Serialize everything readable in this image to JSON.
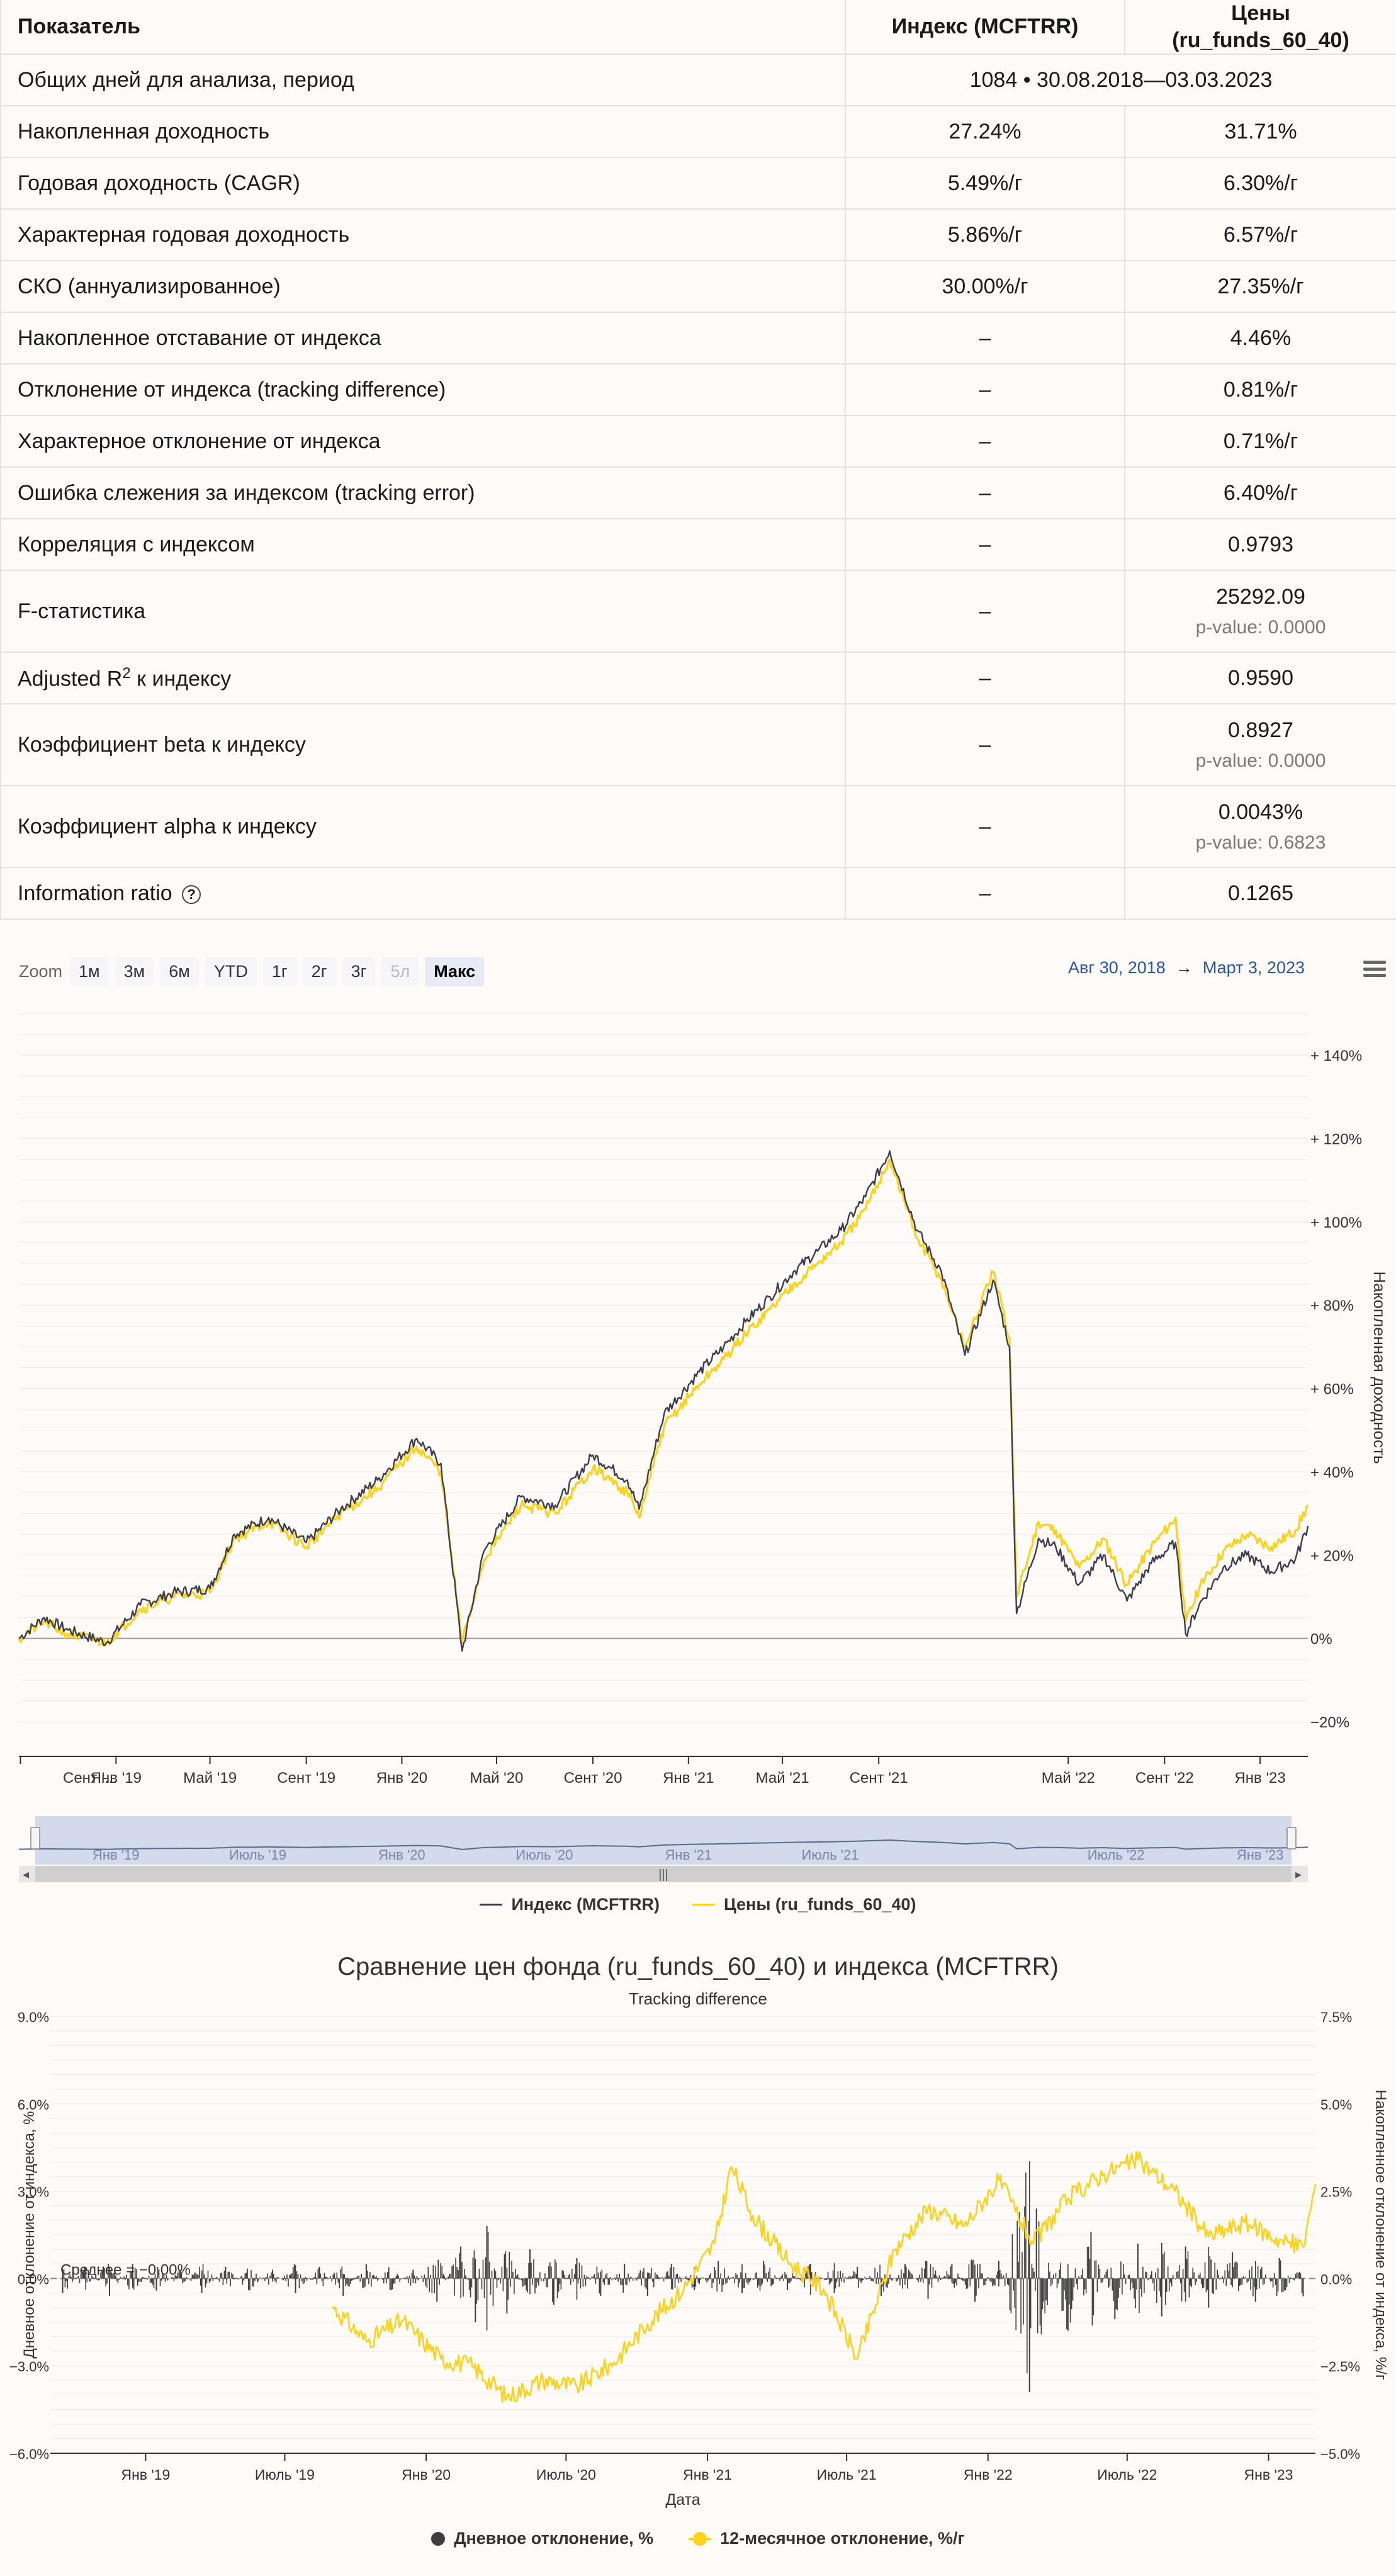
{
  "table": {
    "headers": [
      "Показатель",
      "Индекс (MCFTRR)",
      "Цены (ru_funds_60_40)"
    ],
    "period_row": {
      "label": "Общих дней для анализа, период",
      "value": "1084 • 30.08.2018—03.03.2023"
    },
    "rows": [
      {
        "label": "Накопленная доходность",
        "index": "27.24%",
        "fund": "31.71%"
      },
      {
        "label": "Годовая доходность (CAGR)",
        "index": "5.49%/г",
        "fund": "6.30%/г"
      },
      {
        "label": "Характерная годовая доходность",
        "index": "5.86%/г",
        "fund": "6.57%/г"
      },
      {
        "label": "СКО (аннуализированное)",
        "index": "30.00%/г",
        "fund": "27.35%/г"
      },
      {
        "label": "Накопленное отставание от индекса",
        "index": "–",
        "fund": "4.46%"
      },
      {
        "label": "Отклонение от индекса (tracking difference)",
        "index": "–",
        "fund": "0.81%/г"
      },
      {
        "label": "Характерное отклонение от индекса",
        "index": "–",
        "fund": "0.71%/г"
      },
      {
        "label": "Ошибка слежения за индексом (tracking error)",
        "index": "–",
        "fund": "6.40%/г"
      },
      {
        "label": "Корреляция с индексом",
        "index": "–",
        "fund": "0.9793"
      }
    ],
    "fstat": {
      "label": "F-статистика",
      "index": "–",
      "fund": "25292.09",
      "pvalue": "p-value: 0.0000"
    },
    "adj_r2": {
      "label_pre": "Adjusted R",
      "label_sup": "2",
      "label_post": " к индексу",
      "index": "–",
      "fund": "0.9590"
    },
    "beta": {
      "label": "Коэффициент beta к индексу",
      "index": "–",
      "fund": "0.8927",
      "pvalue": "p-value: 0.0000"
    },
    "alpha": {
      "label": "Коэффициент alpha к индексу",
      "index": "–",
      "fund": "0.0043%",
      "pvalue": "p-value: 0.6823"
    },
    "info_ratio": {
      "label": "Information ratio",
      "help": "?",
      "index": "–",
      "fund": "0.1265"
    }
  },
  "chart1_controls": {
    "zoom_label": "Zoom",
    "zoom_buttons": [
      "1м",
      "3м",
      "6м",
      "YTD",
      "1г",
      "2г",
      "3г",
      "5л",
      "Макс"
    ],
    "disabled_button": "5л",
    "active_button": "Макс",
    "range_from": "Авг 30, 2018",
    "range_arrow": "→",
    "range_to": "Март 3, 2023"
  },
  "colors": {
    "index": "#3d3d4c",
    "fund": "#ffd21a",
    "grid": "#e9e6e4",
    "navigator": "#cbd3ea",
    "accent_link": "#2a55a5"
  },
  "chart_data": [
    {
      "type": "line",
      "ylabel": "Накопленная доходность",
      "ylim": [
        -20,
        150
      ],
      "y_ticks": [
        "+ 140%",
        "+ 120%",
        "+ 100%",
        "+ 80%",
        "+ 60%",
        "+ 40%",
        "+ 20%",
        "0%",
        "−20%"
      ],
      "y_tick_values": [
        140,
        120,
        100,
        80,
        60,
        40,
        20,
        0,
        -20
      ],
      "x_ticks": [
        "Сент '...",
        "Янв '19",
        "Май '19",
        "Сент '19",
        "Янв '20",
        "Май '20",
        "Сент '20",
        "Янв '21",
        "Май '21",
        "Сент '21",
        "Май '22",
        "Сент '22",
        "Янв '23"
      ],
      "x_tick_dates": [
        "2018-09-01",
        "2019-01-01",
        "2019-05-01",
        "2019-09-01",
        "2020-01-01",
        "2020-05-01",
        "2020-09-01",
        "2021-01-01",
        "2021-05-01",
        "2021-09-01",
        "2022-05-01",
        "2022-09-01",
        "2023-01-01"
      ],
      "x_range": [
        "2018-08-30",
        "2023-03-03"
      ],
      "navigator_ticks": [
        "Янв '19",
        "Июль '19",
        "Янв '20",
        "Июль '20",
        "Янв '21",
        "Июль '21",
        "Июль '22",
        "Янв '23"
      ],
      "navigator_tick_dates": [
        "2019-01-01",
        "2019-07-01",
        "2020-01-01",
        "2020-07-01",
        "2021-01-01",
        "2021-07-01",
        "2022-07-01",
        "2023-01-01"
      ],
      "series": [
        {
          "name": "Индекс (MCFTRR)",
          "x": [
            "2018-08-30",
            "2018-10-01",
            "2018-11-01",
            "2018-12-20",
            "2019-02-01",
            "2019-03-15",
            "2019-05-01",
            "2019-06-01",
            "2019-07-15",
            "2019-09-01",
            "2019-10-15",
            "2019-12-01",
            "2020-01-20",
            "2020-02-20",
            "2020-03-18",
            "2020-04-15",
            "2020-06-01",
            "2020-07-15",
            "2020-09-01",
            "2020-10-15",
            "2020-10-30",
            "2020-12-01",
            "2021-01-15",
            "2021-02-15",
            "2021-03-15",
            "2021-04-15",
            "2021-05-15",
            "2021-06-15",
            "2021-07-15",
            "2021-08-15",
            "2021-09-15",
            "2021-10-20",
            "2021-11-20",
            "2021-12-20",
            "2022-01-25",
            "2022-02-15",
            "2022-02-24",
            "2022-03-24",
            "2022-04-15",
            "2022-05-15",
            "2022-06-15",
            "2022-07-15",
            "2022-08-15",
            "2022-09-15",
            "2022-09-28",
            "2022-10-15",
            "2022-11-15",
            "2022-12-15",
            "2023-01-15",
            "2023-02-15",
            "2023-03-03"
          ],
          "y": [
            0,
            5,
            2,
            -1,
            8,
            11,
            12,
            25,
            29,
            23,
            31,
            38,
            48,
            42,
            -3,
            21,
            34,
            32,
            44,
            38,
            31,
            54,
            64,
            70,
            76,
            82,
            88,
            93,
            98,
            106,
            117,
            98,
            88,
            68,
            86,
            70,
            6,
            24,
            22,
            13,
            20,
            9,
            18,
            23,
            1,
            8,
            17,
            20,
            16,
            19,
            27
          ]
        },
        {
          "name": "Цены (ru_funds_60_40)",
          "x": [
            "2018-08-30",
            "2018-10-01",
            "2018-11-01",
            "2018-12-20",
            "2019-02-01",
            "2019-03-15",
            "2019-05-01",
            "2019-06-01",
            "2019-07-15",
            "2019-09-01",
            "2019-10-15",
            "2019-12-01",
            "2020-01-20",
            "2020-02-20",
            "2020-03-18",
            "2020-04-15",
            "2020-06-01",
            "2020-07-15",
            "2020-09-01",
            "2020-10-15",
            "2020-10-30",
            "2020-12-01",
            "2021-01-15",
            "2021-02-15",
            "2021-03-15",
            "2021-04-15",
            "2021-05-15",
            "2021-06-15",
            "2021-07-15",
            "2021-08-15",
            "2021-09-15",
            "2021-10-20",
            "2021-11-20",
            "2021-12-20",
            "2022-01-25",
            "2022-02-15",
            "2022-02-24",
            "2022-03-24",
            "2022-04-15",
            "2022-05-15",
            "2022-06-15",
            "2022-07-15",
            "2022-08-15",
            "2022-09-15",
            "2022-09-28",
            "2022-10-15",
            "2022-11-15",
            "2022-12-15",
            "2023-01-15",
            "2023-02-15",
            "2023-03-03"
          ],
          "y": [
            0,
            4,
            1,
            -1,
            7,
            10,
            11,
            24,
            28,
            22,
            30,
            36,
            46,
            40,
            -1,
            19,
            32,
            30,
            41,
            35,
            29,
            51,
            61,
            67,
            73,
            79,
            85,
            90,
            95,
            103,
            115,
            96,
            86,
            70,
            88,
            72,
            10,
            28,
            26,
            17,
            24,
            13,
            22,
            29,
            4,
            12,
            21,
            25,
            22,
            26,
            32
          ]
        }
      ]
    },
    {
      "type": "bar",
      "title": "Сравнение цен фонда (ru_funds_60_40) и индекса (MCFTRR)",
      "subtitle": "Tracking difference",
      "xlabel": "Дата",
      "ylabel": "Дневное отклонение от индекса, %",
      "ylabel_right": "Накопленное отклонение от индекса, %/г",
      "ylim": [
        -6,
        9
      ],
      "ylim_right": [
        -5,
        7.5
      ],
      "y_ticks": [
        "9.0%",
        "6.0%",
        "3.0%",
        "0.0%",
        "−3.0%",
        "−6.0%"
      ],
      "y_tick_values": [
        9,
        6,
        3,
        0,
        -3,
        -6
      ],
      "y_ticks_right": [
        "7.5%",
        "5.0%",
        "2.5%",
        "0.0%",
        "−2.5%",
        "−5.0%"
      ],
      "y_tick_values_right": [
        7.5,
        5,
        2.5,
        0,
        -2.5,
        -5
      ],
      "x_ticks": [
        "Янв '19",
        "Июль '19",
        "Янв '20",
        "Июль '20",
        "Янв '21",
        "Июль '21",
        "Янв '22",
        "Июль '22",
        "Янв '23"
      ],
      "x_tick_dates": [
        "2019-01-01",
        "2019-07-01",
        "2020-01-01",
        "2020-07-01",
        "2021-01-01",
        "2021-07-01",
        "2022-01-01",
        "2022-07-01",
        "2023-01-01"
      ],
      "x_range": [
        "2018-08-30",
        "2023-03-03"
      ],
      "mean_label": "Среднее = −0.00%",
      "mean_value": 0,
      "series": [
        {
          "name": "Дневное отклонение, %",
          "x": [
            "2018-09-15",
            "2018-10-15",
            "2018-11-15",
            "2018-12-15",
            "2019-01-15",
            "2019-02-15",
            "2019-03-15",
            "2019-04-15",
            "2019-05-15",
            "2019-06-15",
            "2019-07-15",
            "2019-08-15",
            "2019-09-15",
            "2019-10-15",
            "2019-11-15",
            "2019-12-15",
            "2020-01-15",
            "2020-02-15",
            "2020-03-05",
            "2020-03-20",
            "2020-04-15",
            "2020-05-15",
            "2020-06-15",
            "2020-07-15",
            "2020-08-15",
            "2020-09-15",
            "2020-10-15",
            "2020-11-15",
            "2020-12-15",
            "2021-01-15",
            "2021-02-15",
            "2021-03-15",
            "2021-04-15",
            "2021-05-15",
            "2021-06-15",
            "2021-07-15",
            "2021-08-15",
            "2021-09-15",
            "2021-10-15",
            "2021-11-15",
            "2021-12-15",
            "2022-01-15",
            "2022-02-24",
            "2022-03-05",
            "2022-04-15",
            "2022-05-15",
            "2022-06-15",
            "2022-07-15",
            "2022-08-15",
            "2022-09-15",
            "2022-10-15",
            "2022-11-15",
            "2022-12-15",
            "2023-01-15",
            "2023-02-15"
          ],
          "y": [
            -0.5,
            0.4,
            -0.6,
            0.5,
            -0.4,
            0.3,
            -0.5,
            0.4,
            -0.4,
            0.3,
            -0.5,
            0.4,
            -0.6,
            0.5,
            -0.4,
            0.3,
            -0.8,
            1.1,
            -1.5,
            1.8,
            -1.2,
            1.0,
            -0.9,
            0.7,
            -0.6,
            0.5,
            -0.6,
            0.5,
            -0.4,
            0.6,
            -0.5,
            0.6,
            -0.4,
            0.5,
            -0.5,
            0.4,
            -0.6,
            0.5,
            -0.7,
            0.5,
            -0.8,
            0.6,
            -3.9,
            2.4,
            -1.8,
            1.6,
            -1.4,
            1.2,
            -1.3,
            1.1,
            -1.0,
            0.9,
            -0.8,
            0.7,
            -0.6
          ]
        },
        {
          "name": "12-месячное отклонение, %/г",
          "x": [
            "2019-09-01",
            "2019-10-15",
            "2019-12-01",
            "2020-01-20",
            "2020-03-01",
            "2020-04-15",
            "2020-06-01",
            "2020-07-15",
            "2020-09-01",
            "2020-10-15",
            "2020-12-01",
            "2021-01-10",
            "2021-02-01",
            "2021-03-01",
            "2021-04-15",
            "2021-06-01",
            "2021-07-15",
            "2021-09-01",
            "2021-10-15",
            "2021-12-01",
            "2022-01-15",
            "2022-03-01",
            "2022-04-15",
            "2022-06-01",
            "2022-07-15",
            "2022-09-01",
            "2022-10-15",
            "2022-12-01",
            "2023-01-15",
            "2023-02-15",
            "2023-03-03"
          ],
          "y": [
            -0.8,
            -1.8,
            -1.2,
            -2.3,
            -2.5,
            -3.4,
            -2.9,
            -3.1,
            -2.4,
            -1.3,
            -0.3,
            1.0,
            3.2,
            1.8,
            0.5,
            -0.3,
            -2.3,
            0.8,
            2.0,
            1.5,
            2.8,
            1.0,
            2.3,
            3.0,
            3.4,
            2.5,
            1.2,
            1.6,
            1.1,
            0.9,
            2.7
          ]
        }
      ]
    }
  ],
  "legend1": {
    "index": "Индекс (MCFTRR)",
    "fund": "Цены (ru_funds_60_40)"
  },
  "legend2": {
    "daily": "Дневное отклонение, %",
    "rolling": "12-месячное отклонение, %/г"
  },
  "chart2_text": {
    "title": "Сравнение цен фонда (ru_funds_60_40) и индекса (MCFTRR)",
    "subtitle": "Tracking difference"
  },
  "icons": {
    "menu": "hamburger-menu-icon",
    "help": "question-circle-icon",
    "scroll_left": "arrow-left-icon",
    "scroll_right": "arrow-right-icon",
    "scroll_grip": "grip-icon"
  }
}
